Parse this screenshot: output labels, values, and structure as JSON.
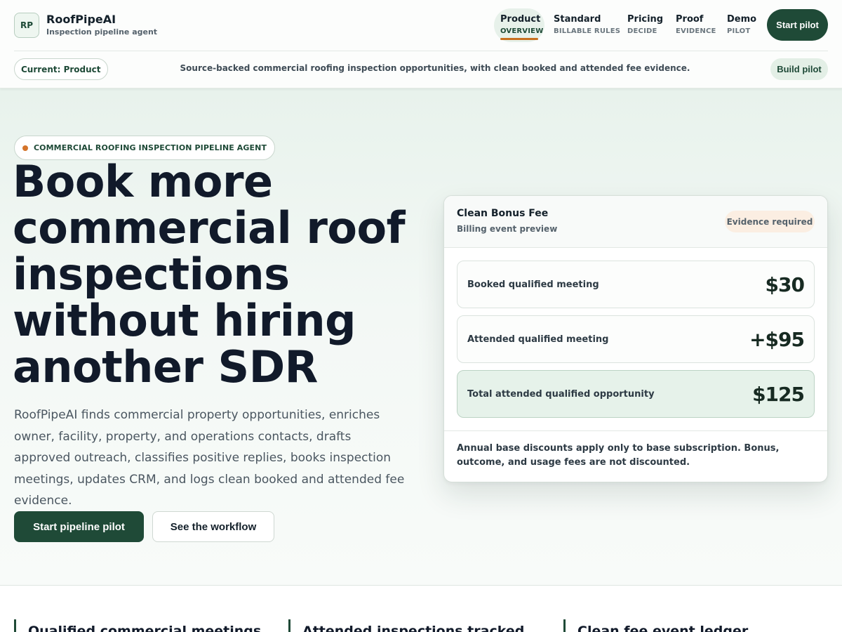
{
  "brand": {
    "logo_initials": "RP",
    "name": "RoofPipeAI",
    "tagline": "Inspection pipeline agent"
  },
  "nav": {
    "items": [
      {
        "label": "Product",
        "sublabel": "OVERVIEW",
        "active": true
      },
      {
        "label": "Standard",
        "sublabel": "BILLABLE RULES",
        "active": false
      },
      {
        "label": "Pricing",
        "sublabel": "DECIDE",
        "active": false
      },
      {
        "label": "Proof",
        "sublabel": "EVIDENCE",
        "active": false
      },
      {
        "label": "Demo",
        "sublabel": "PILOT",
        "active": false
      }
    ],
    "cta_label": "Start pilot"
  },
  "subbar": {
    "current_label": "Current: Product",
    "strapline": "Source-backed commercial roofing inspection opportunities, with clean booked and attended fee evidence.",
    "build_label": "Build pilot"
  },
  "hero": {
    "eyebrow": "COMMERCIAL ROOFING INSPECTION PIPELINE AGENT",
    "headline": "Book more commercial roof inspections without hiring another SDR",
    "lede": "RoofPipeAI finds commercial property opportunities, enriches owner, facility, property, and operations contacts, drafts approved outreach, classifies positive replies, books inspection meetings, updates CRM, and logs clean booked and attended fee evidence.",
    "primary_cta": "Start pipeline pilot",
    "secondary_cta": "See the workflow"
  },
  "fee_card": {
    "title": "Clean Bonus Fee",
    "subtitle": "Billing event preview",
    "badge": "Evidence required",
    "rows": [
      {
        "label": "Booked qualified meeting",
        "amount": "$30"
      },
      {
        "label": "Attended qualified meeting",
        "amount": "+$95"
      },
      {
        "label": "Total attended qualified opportunity",
        "amount": "$125"
      }
    ],
    "note": "Annual base discounts apply only to base subscription. Bonus, outcome, and usage fees are not discounted."
  },
  "features": [
    {
      "title": "Qualified commercial meetings"
    },
    {
      "title": "Attended inspections tracked"
    },
    {
      "title": "Clean fee event ledger"
    }
  ],
  "colors": {
    "brand_green": "#1f4a37",
    "accent_orange": "#c7701f",
    "ink": "#111a2a",
    "hero_bg": "#e8f2ec"
  }
}
